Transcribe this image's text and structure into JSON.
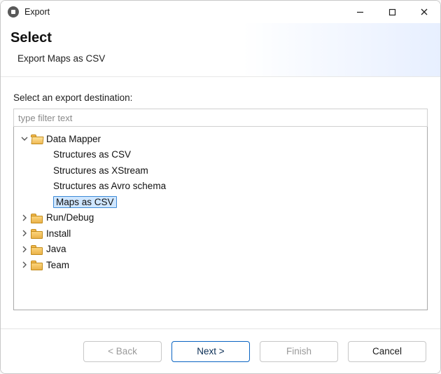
{
  "titlebar": {
    "title": "Export"
  },
  "header": {
    "heading": "Select",
    "subtitle": "Export Maps as CSV"
  },
  "body": {
    "prompt": "Select an export destination:",
    "filter_placeholder": "type filter text"
  },
  "tree": {
    "root": {
      "label": "Data Mapper",
      "expanded": true,
      "children": [
        {
          "label": "Structures as CSV"
        },
        {
          "label": "Structures as XStream"
        },
        {
          "label": "Structures as Avro schema"
        },
        {
          "label": "Maps as CSV",
          "selected": true
        }
      ]
    },
    "siblings": [
      {
        "label": "Run/Debug"
      },
      {
        "label": "Install"
      },
      {
        "label": "Java"
      },
      {
        "label": "Team"
      }
    ]
  },
  "footer": {
    "back": "< Back",
    "next": "Next >",
    "finish": "Finish",
    "cancel": "Cancel"
  }
}
